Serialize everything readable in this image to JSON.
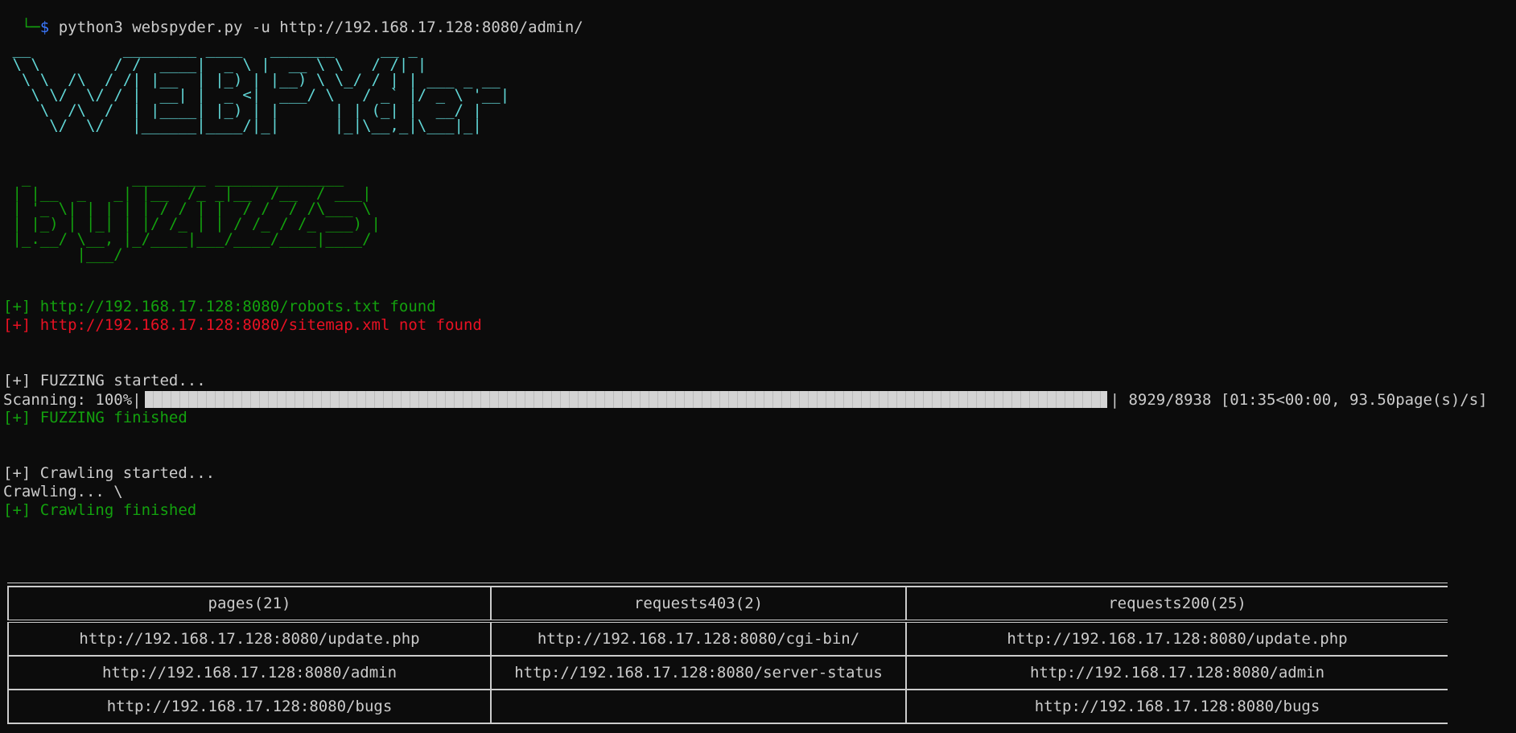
{
  "terminal": {
    "prompt_corner": "└─",
    "prompt_symbol": "$",
    "command": "python3 webspyder.py -u http://192.168.17.128:8080/admin/",
    "banner_webspyder": " __          ________ ____   _______     __ _\n \\ \\        / /  ____|  _ \\ |  __ \\ \\   / /| |\n  \\ \\  /\\  / /| |__  | |_) | |__) \\ \\_/ / | | ___ _ __\n   \\ \\/  \\/ / |  __| |  _ <|  ___/ \\   / _` |/ _ \\ '__|\n    \\  /\\  /  | |____| |_) | |      | | (_| |  __/ |\n     \\/  \\/   |______|____/|_|      |_|\\__,_|\\___|_|",
    "banner_byliz": "  _           ________ ______________\n | |__  _   _| |__  /_ _|__  /__  / ___|\n | '_ \\| | | | | / / | |  / /  / /\\___ \\\n | |_) | |_| | |/ /_ | | / /_ / /_ ___) |\n |_.__/ \\__, |_/____|___/____/____|____/\n        |___/",
    "robots_line": "[+] http://192.168.17.128:8080/robots.txt found",
    "sitemap_line": "[+] http://192.168.17.128:8080/sitemap.xml not found",
    "fuzzing_started": "[+] FUZZING started...",
    "scanning_label": "Scanning: 100%|",
    "scanning_stats": "| 8929/8938 [01:35<00:00, 93.50page(s)/s]",
    "scan_progress_fraction": 1.0,
    "fuzzing_finished": "[+] FUZZING finished",
    "crawling_started": "[+] Crawling started...",
    "crawling_spinner": "Crawling... \\",
    "crawling_finished": "[+] Crawling finished"
  },
  "results_table": {
    "columns": [
      "pages(21)",
      "requests403(2)",
      "requests200(25)"
    ],
    "rows": [
      [
        "http://192.168.17.128:8080/update.php",
        "http://192.168.17.128:8080/cgi-bin/",
        "http://192.168.17.128:8080/update.php"
      ],
      [
        "http://192.168.17.128:8080/admin",
        "http://192.168.17.128:8080/server-status",
        "http://192.168.17.128:8080/admin"
      ],
      [
        "http://192.168.17.128:8080/bugs",
        "",
        "http://192.168.17.128:8080/bugs"
      ]
    ]
  },
  "colors": {
    "background": "#0c0c0c",
    "text": "#cccccc",
    "green": "#13a10e",
    "red": "#e81123",
    "cyan": "#61d6d6",
    "blue": "#3b78ff"
  }
}
